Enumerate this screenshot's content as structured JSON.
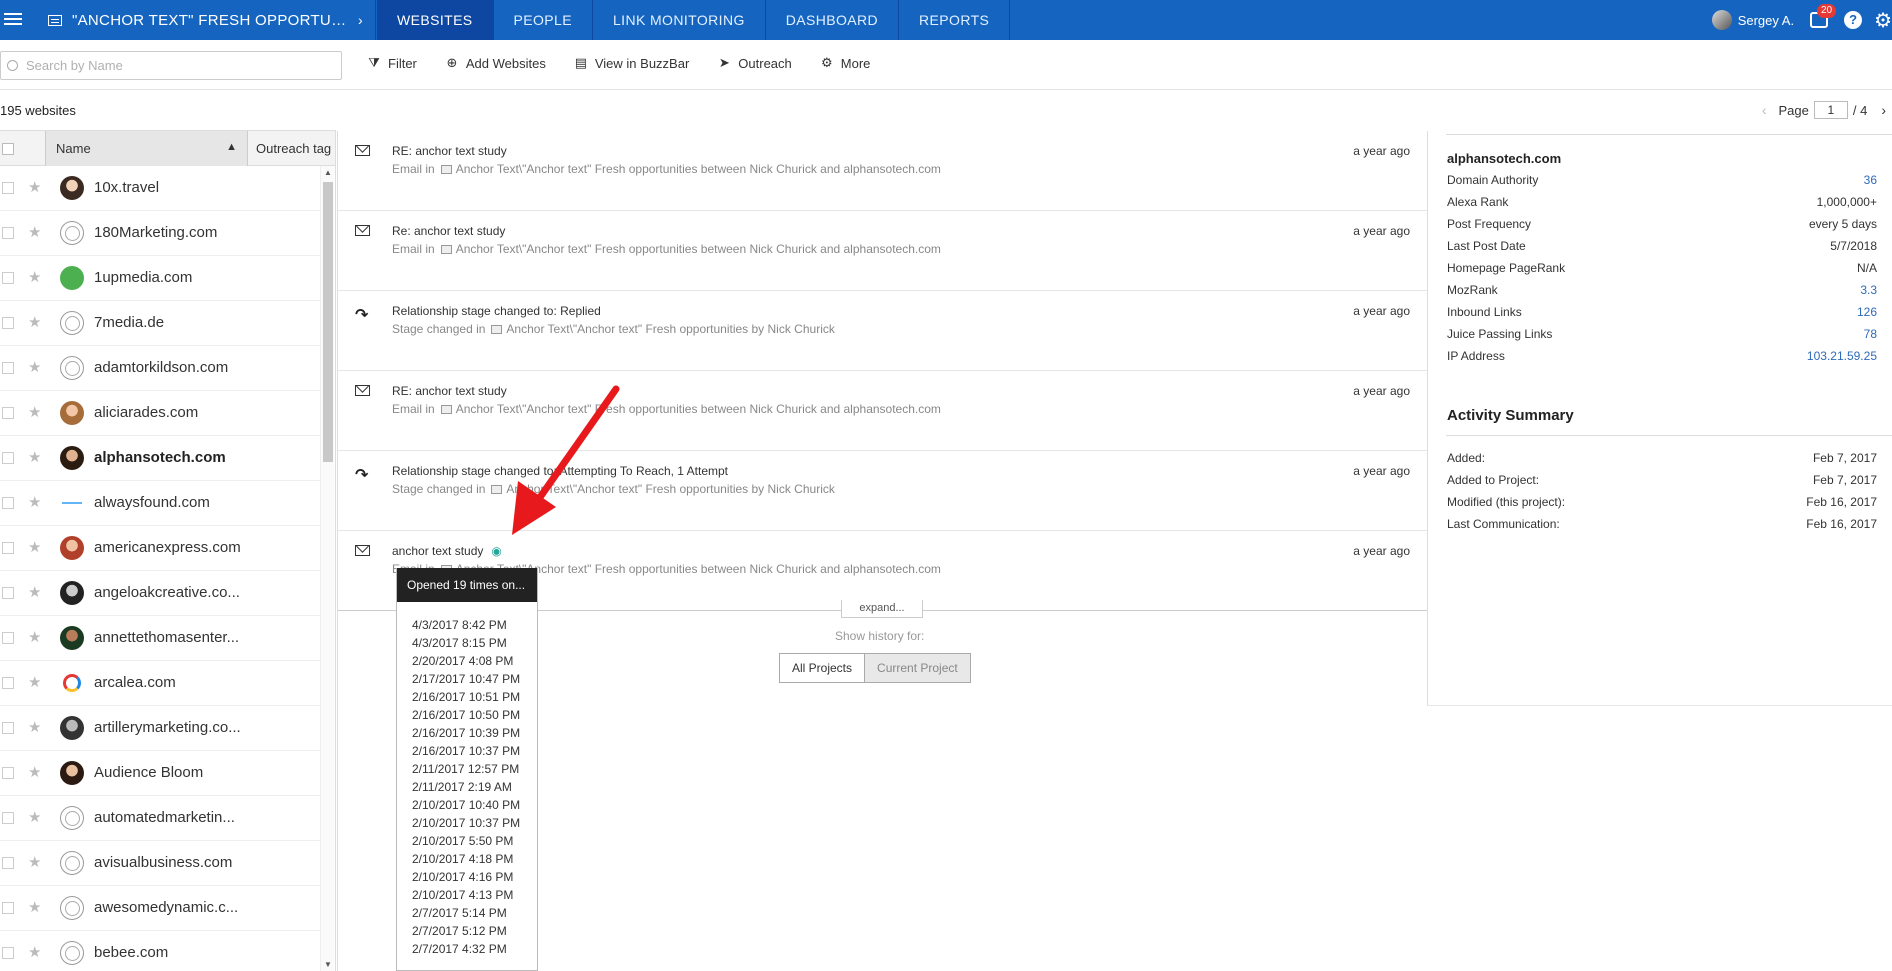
{
  "header": {
    "project_title": "\"ANCHOR TEXT\" FRESH OPPORTUNITIES",
    "tabs": [
      {
        "label": "WEBSITES",
        "active": true
      },
      {
        "label": "PEOPLE",
        "active": false
      },
      {
        "label": "LINK MONITORING",
        "active": false
      },
      {
        "label": "DASHBOARD",
        "active": false
      },
      {
        "label": "REPORTS",
        "active": false
      }
    ],
    "user_name": "Sergey A.",
    "notification_count": "20",
    "help_label": "?"
  },
  "toolbar": {
    "search_placeholder": "Search by Name",
    "buttons": [
      {
        "label": "Filter",
        "icon": "filter-icon"
      },
      {
        "label": "Add Websites",
        "icon": "add-website-icon"
      },
      {
        "label": "View in BuzzBar",
        "icon": "buzzbar-icon"
      },
      {
        "label": "Outreach",
        "icon": "paper-plane-icon"
      },
      {
        "label": "More",
        "icon": "gears-icon"
      }
    ]
  },
  "list": {
    "count": "195 websites",
    "page_label": "Page",
    "page_current": "1",
    "page_total": "/ 4",
    "columns": {
      "name": "Name",
      "tag": "Outreach tag"
    },
    "items": [
      {
        "name": "10x.travel",
        "fav": "f-photo1"
      },
      {
        "name": "180Marketing.com",
        "fav": "f-globe"
      },
      {
        "name": "1upmedia.com",
        "fav": "f-green"
      },
      {
        "name": "7media.de",
        "fav": "f-globe"
      },
      {
        "name": "adamtorkildson.com",
        "fav": "f-globe"
      },
      {
        "name": "aliciarades.com",
        "fav": "f-photo2"
      },
      {
        "name": "alphansotech.com",
        "fav": "f-photo3",
        "selected": true
      },
      {
        "name": "alwaysfound.com",
        "fav": "f-blue"
      },
      {
        "name": "americanexpress.com",
        "fav": "f-photo4"
      },
      {
        "name": "angeloakcreative.co...",
        "fav": "f-photo5"
      },
      {
        "name": "annettethomasenter...",
        "fav": "f-photo6"
      },
      {
        "name": "arcalea.com",
        "fav": "f-ring"
      },
      {
        "name": "artillerymarketing.co...",
        "fav": "f-photo7"
      },
      {
        "name": "Audience Bloom",
        "fav": "f-photo8"
      },
      {
        "name": "automatedmarketin...",
        "fav": "f-globe"
      },
      {
        "name": "avisualbusiness.com",
        "fav": "f-globe"
      },
      {
        "name": "awesomedynamic.c...",
        "fav": "f-globe"
      },
      {
        "name": "bebee.com",
        "fav": "f-globe"
      }
    ]
  },
  "history": {
    "items": [
      {
        "icon": "email",
        "title": "RE: anchor text study",
        "sub_prefix": "Email in",
        "sub_text": "Anchor Text\\\"Anchor text\" Fresh opportunities between Nick Churick and alphansotech.com",
        "date": "a year ago"
      },
      {
        "icon": "email",
        "title": "Re: anchor text study",
        "sub_prefix": "Email in",
        "sub_text": "Anchor Text\\\"Anchor text\" Fresh opportunities between Nick Churick and alphansotech.com",
        "date": "a year ago"
      },
      {
        "icon": "stage",
        "title": "Relationship stage changed to: Replied",
        "sub_prefix": "Stage changed in",
        "sub_text": "Anchor Text\\\"Anchor text\" Fresh opportunities by Nick Churick",
        "date": "a year ago"
      },
      {
        "icon": "email",
        "title": "RE: anchor text study",
        "sub_prefix": "Email in",
        "sub_text": "Anchor Text\\\"Anchor text\" Fresh opportunities between Nick Churick and alphansotech.com",
        "date": "a year ago"
      },
      {
        "icon": "stage",
        "title": "Relationship stage changed to: Attempting To Reach, 1 Attempt",
        "sub_prefix": "Stage changed in",
        "sub_text": "Anchor Text\\\"Anchor text\" Fresh opportunities by Nick Churick",
        "date": "a year ago"
      },
      {
        "icon": "email",
        "title": "anchor text study",
        "sub_prefix": "Email in",
        "sub_text": "Anchor Text\\\"Anchor text\" Fresh opportunities between Nick Churick and alphansotech.com",
        "date": "a year ago",
        "opened": true
      }
    ],
    "expand_label": "expand...",
    "show_history_label": "Show history for:",
    "all_projects": "All Projects",
    "current_project": "Current Project"
  },
  "tooltip": {
    "header": "Opened 19 times on...",
    "times": [
      "4/3/2017 8:42 PM",
      "4/3/2017 8:15 PM",
      "2/20/2017 4:08 PM",
      "2/17/2017 10:47 PM",
      "2/16/2017 10:51 PM",
      "2/16/2017 10:50 PM",
      "2/16/2017 10:39 PM",
      "2/16/2017 10:37 PM",
      "2/11/2017 12:57 PM",
      "2/11/2017 2:19 AM",
      "2/10/2017 10:40 PM",
      "2/10/2017 10:37 PM",
      "2/10/2017 5:50 PM",
      "2/10/2017 4:18 PM",
      "2/10/2017 4:16 PM",
      "2/10/2017 4:13 PM",
      "2/7/2017 5:14 PM",
      "2/7/2017 5:12 PM",
      "2/7/2017 4:32 PM"
    ]
  },
  "details": {
    "domain": "alphansotech.com",
    "metrics": [
      {
        "label": "Domain Authority",
        "value": "36",
        "link": true
      },
      {
        "label": "Alexa Rank",
        "value": "1,000,000+",
        "link": false
      },
      {
        "label": "Post Frequency",
        "value": "every 5 days",
        "link": false
      },
      {
        "label": "Last Post Date",
        "value": "5/7/2018",
        "link": false
      },
      {
        "label": "Homepage PageRank",
        "value": "N/A",
        "link": false
      },
      {
        "label": "MozRank",
        "value": "3.3",
        "link": true
      },
      {
        "label": "Inbound Links",
        "value": "126",
        "link": true
      },
      {
        "label": "Juice Passing Links",
        "value": "78",
        "link": true
      },
      {
        "label": "IP Address",
        "value": "103.21.59.25",
        "link": true
      }
    ],
    "activity_title": "Activity Summary",
    "activity": [
      {
        "label": "Added:",
        "value": "Feb 7, 2017"
      },
      {
        "label": "Added to Project:",
        "value": "Feb 7, 2017"
      },
      {
        "label": "Modified (this project):",
        "value": "Feb 16, 2017"
      },
      {
        "label": "Last Communication:",
        "value": "Feb 16, 2017"
      }
    ]
  },
  "colors": {
    "topbar": "#1565c0",
    "active_tab": "#0d47a1",
    "link": "#2e6bb8",
    "annotation_arrow": "#e8191c"
  }
}
